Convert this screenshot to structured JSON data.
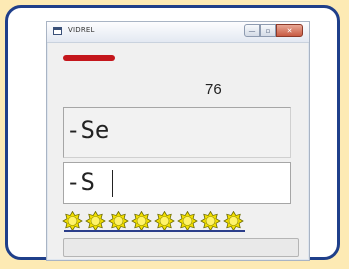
{
  "window": {
    "title": "VIDREL",
    "min_glyph": "—",
    "max_glyph": "▫",
    "close_glyph": "✕"
  },
  "counter": "76",
  "display": {
    "top_text": "-Se",
    "input_value": "-S"
  },
  "stars": {
    "count": 8,
    "color": "#f2de00"
  },
  "progress": {
    "value": 0
  },
  "colors": {
    "background": "#fdeab4",
    "frame": "#1f3f8a",
    "indicator": "#c4161c"
  }
}
